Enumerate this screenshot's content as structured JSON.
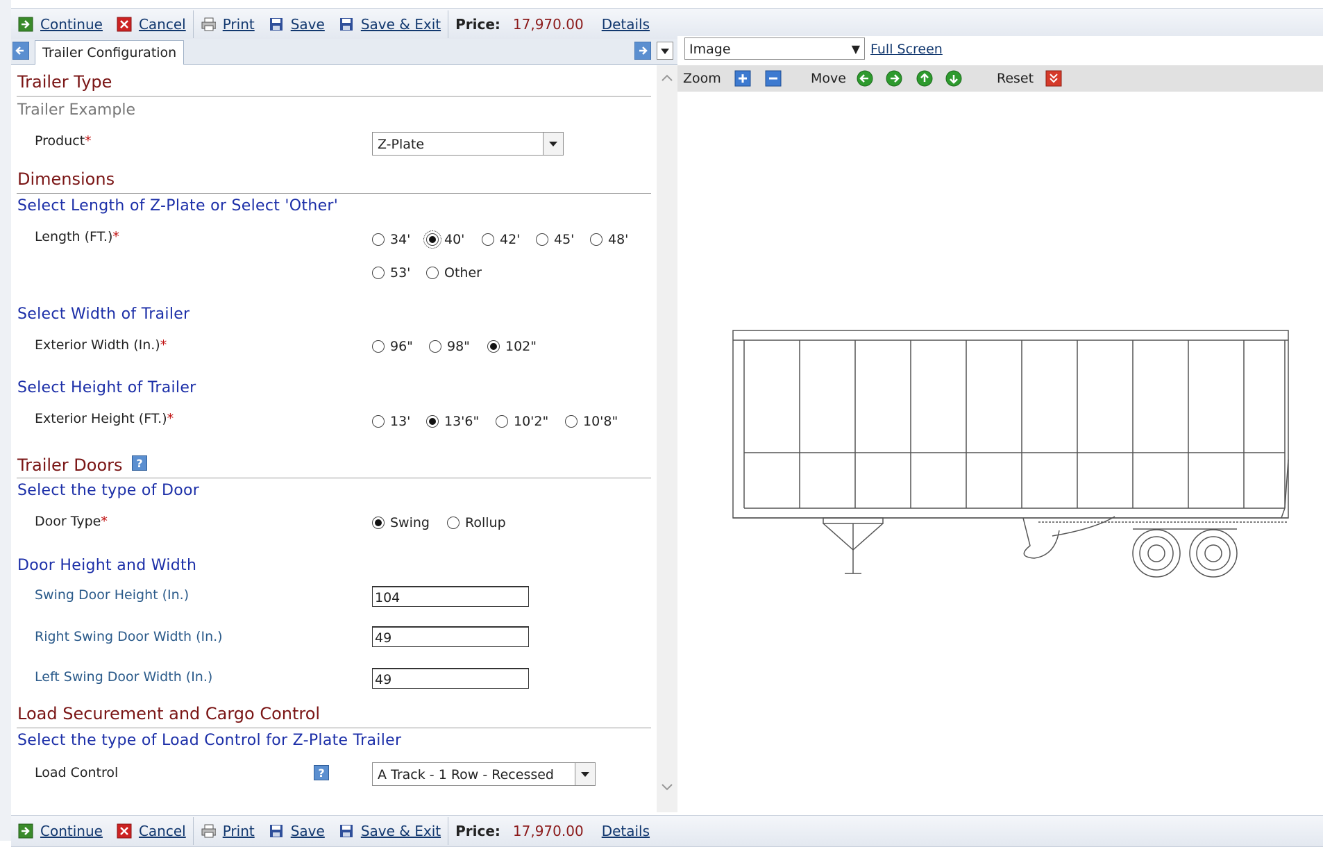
{
  "toolbar": {
    "continue": "Continue",
    "cancel": "Cancel",
    "print": "Print",
    "save": "Save",
    "save_exit": "Save & Exit",
    "price_label": "Price:",
    "price_value": "17,970.00",
    "details": "Details"
  },
  "tabs": {
    "active": "Trailer Configuration"
  },
  "form": {
    "trailer_type": {
      "title": "Trailer Type",
      "example": "Trailer Example",
      "product_label": "Product",
      "product_value": "Z-Plate"
    },
    "dimensions": {
      "title": "Dimensions",
      "length_heading": "Select Length of Z-Plate or Select 'Other'",
      "length_label": "Length (FT.)",
      "length_options": [
        "34'",
        "40'",
        "42'",
        "45'",
        "48'",
        "53'",
        "Other"
      ],
      "length_selected": "40'",
      "width_heading": "Select Width of Trailer",
      "width_label": "Exterior Width (In.)",
      "width_options": [
        "96\"",
        "98\"",
        "102\""
      ],
      "width_selected": "102\"",
      "height_heading": "Select Height of Trailer",
      "height_label": "Exterior Height (FT.)",
      "height_options": [
        "13'",
        "13'6\"",
        "10'2\"",
        "10'8\""
      ],
      "height_selected": "13'6\""
    },
    "doors": {
      "title": "Trailer Doors",
      "help": "?",
      "type_heading": "Select the type of Door",
      "type_label": "Door Type",
      "type_options": [
        "Swing",
        "Rollup"
      ],
      "type_selected": "Swing",
      "hw_heading": "Door Height and Width",
      "swing_height_label": "Swing Door Height (In.)",
      "swing_height_value": "104",
      "right_width_label": "Right Swing Door Width (In.)",
      "right_width_value": "49",
      "left_width_label": "Left Swing Door Width (In.)",
      "left_width_value": "49"
    },
    "load": {
      "title": "Load Securement and Cargo Control",
      "heading": "Select the type of Load Control for Z-Plate Trailer",
      "label": "Load Control",
      "help": "?",
      "value": "A Track - 1 Row - Recessed"
    },
    "required_mark": "*"
  },
  "viewer": {
    "view_select": "Image",
    "full_screen": "Full Screen",
    "zoom_label": "Zoom",
    "move_label": "Move",
    "reset_label": "Reset"
  },
  "colors": {
    "section_title": "#7a1515",
    "sub_title": "#1c2fa8",
    "link": "#12386f",
    "price": "#8b1a1a"
  }
}
